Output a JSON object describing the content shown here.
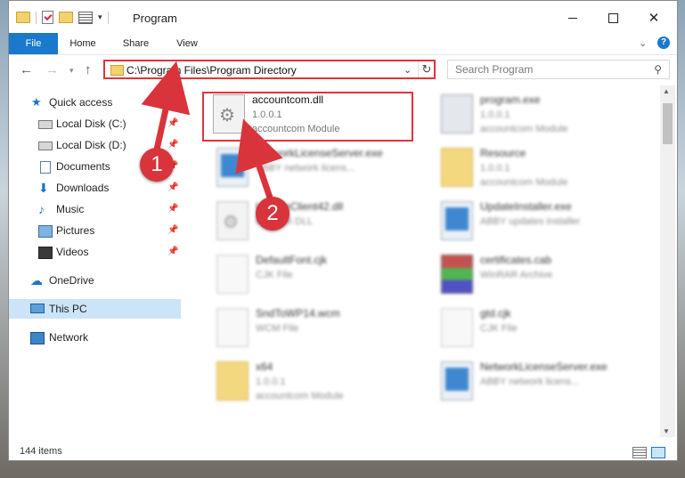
{
  "window": {
    "title": "Program",
    "minimize_symbol": "",
    "close_symbol": "✕"
  },
  "ribbon": {
    "tabs": [
      {
        "label": "File"
      },
      {
        "label": "Home"
      },
      {
        "label": "Share"
      },
      {
        "label": "View"
      }
    ],
    "help_symbol": "?"
  },
  "nav": {
    "address": "C:\\Program Files\\Program Directory",
    "search_placeholder": "Search Program"
  },
  "sidebar": {
    "items": [
      {
        "label": "Quick access",
        "icon": "star-icon"
      },
      {
        "label": "Local Disk (C:)",
        "icon": "disk-icon",
        "pinned": true
      },
      {
        "label": "Local Disk (D:)",
        "icon": "disk-icon",
        "pinned": true
      },
      {
        "label": "Documents",
        "icon": "documents-icon",
        "pinned": true
      },
      {
        "label": "Downloads",
        "icon": "downloads-icon",
        "pinned": true
      },
      {
        "label": "Music",
        "icon": "music-icon",
        "pinned": true
      },
      {
        "label": "Pictures",
        "icon": "pictures-icon",
        "pinned": true
      },
      {
        "label": "Videos",
        "icon": "videos-icon",
        "pinned": true
      },
      {
        "label": "OneDrive",
        "icon": "onedrive-icon"
      },
      {
        "label": "This PC",
        "icon": "pc-icon",
        "selected": true
      },
      {
        "label": "Network",
        "icon": "network-icon"
      }
    ]
  },
  "files": [
    {
      "name": "accountcom.dll",
      "line2": "1.0.0.1",
      "line3": "accountcom Module"
    },
    {
      "name": "program.exe",
      "line2": "1.0.0.1",
      "line3": "accountcom Module"
    },
    {
      "name": "NetworkLicenseServer.exe",
      "line2": "ABBY network licens...",
      "line3": ""
    },
    {
      "name": "Resource",
      "line2": "1.0.0.1",
      "line3": "accountcom Module"
    },
    {
      "name": "UpdateClient42.dll",
      "line2": "Ministeri DLL",
      "line3": ""
    },
    {
      "name": "UpdateInstaller.exe",
      "line2": "ABBY updates installer",
      "line3": ""
    },
    {
      "name": "DefaultFont.cjk",
      "line2": "CJK File",
      "line3": ""
    },
    {
      "name": "certificates.cab",
      "line2": "WinRAR Archive",
      "line3": ""
    },
    {
      "name": "SndToWP14.wcm",
      "line2": "WCM File",
      "line3": ""
    },
    {
      "name": "gtd.cjk",
      "line2": "CJK File",
      "line3": ""
    },
    {
      "name": "x64",
      "line2": "1.0.0.1",
      "line3": "accountcom Module"
    },
    {
      "name": "NetworkLicenseServer.exe",
      "line2": "ABBY network licens...",
      "line3": ""
    }
  ],
  "status": {
    "item_count": "144 items"
  },
  "annotations": {
    "step1": "1",
    "step2": "2",
    "color": "#d9343b"
  }
}
